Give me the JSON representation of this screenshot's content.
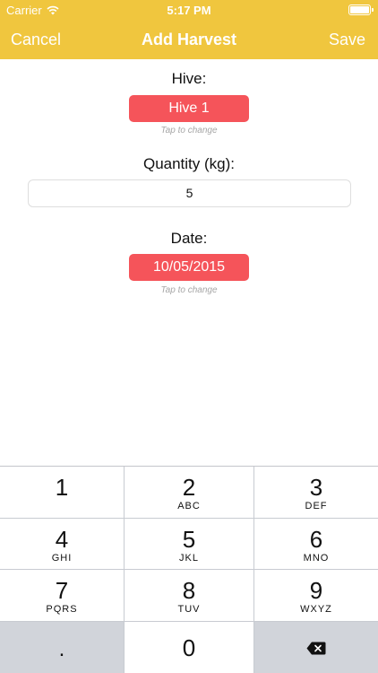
{
  "status_bar": {
    "carrier": "Carrier",
    "time": "5:17 PM",
    "wifi_icon": "wifi-icon",
    "battery_icon": "battery-icon"
  },
  "nav": {
    "cancel_label": "Cancel",
    "title": "Add Harvest",
    "save_label": "Save"
  },
  "form": {
    "hive_label": "Hive:",
    "hive_value": "Hive 1",
    "hive_hint": "Tap to change",
    "quantity_label": "Quantity (kg):",
    "quantity_value": "5",
    "date_label": "Date:",
    "date_value": "10/05/2015",
    "date_hint": "Tap to change"
  },
  "keypad": {
    "keys": [
      {
        "num": "1",
        "letters": ""
      },
      {
        "num": "2",
        "letters": "ABC"
      },
      {
        "num": "3",
        "letters": "DEF"
      },
      {
        "num": "4",
        "letters": "GHI"
      },
      {
        "num": "5",
        "letters": "JKL"
      },
      {
        "num": "6",
        "letters": "MNO"
      },
      {
        "num": "7",
        "letters": "PQRS"
      },
      {
        "num": "8",
        "letters": "TUV"
      },
      {
        "num": "9",
        "letters": "WXYZ"
      }
    ],
    "decimal": ".",
    "zero": "0",
    "backspace_icon": "backspace-icon"
  },
  "colors": {
    "nav_background": "#f0c63e",
    "button_red": "#f5545a",
    "keypad_dark_key": "#d1d4da"
  }
}
